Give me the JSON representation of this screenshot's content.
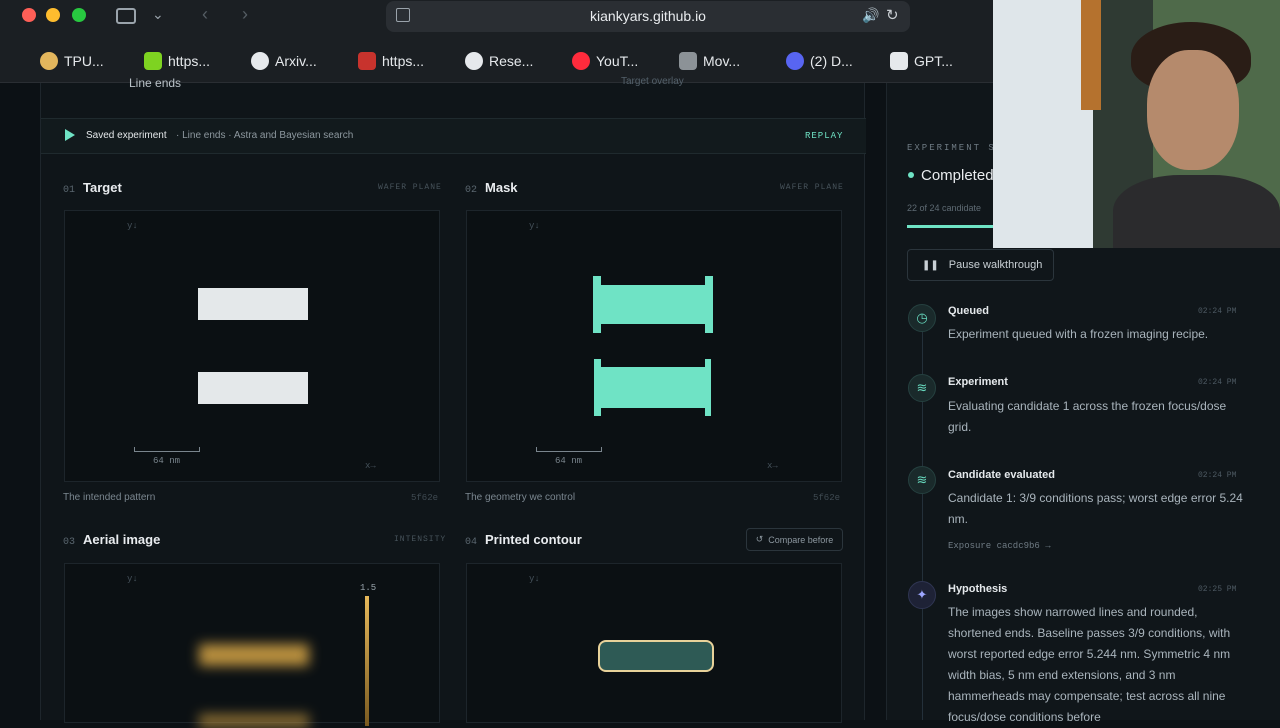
{
  "browser": {
    "url": "kiankyars.github.io",
    "bookmarks": [
      "TPU...",
      "https...",
      "Arxiv...",
      "https...",
      "Rese...",
      "YouT...",
      "Mov...",
      "(2) D...",
      "GPT..."
    ]
  },
  "main": {
    "header_partial": "Line ends",
    "header_right_partial": "Target overlay",
    "banner": {
      "saved_label": "Saved experiment",
      "detail": "· Line ends · Astra and Bayesian search",
      "replay": "REPLAY"
    },
    "panels": [
      {
        "num": "01",
        "title": "Target",
        "tag": "WAFER PLANE",
        "caption": "The intended pattern",
        "hash": "5f62e",
        "scale": "64 nm"
      },
      {
        "num": "02",
        "title": "Mask",
        "tag": "WAFER PLANE",
        "caption": "The geometry we control",
        "hash": "5f62e",
        "scale": "64 nm"
      },
      {
        "num": "03",
        "title": "Aerial image",
        "tag": "INTENSITY",
        "colorbar_max": "1.5"
      },
      {
        "num": "04",
        "title": "Printed contour",
        "compare_button": "Compare before"
      }
    ],
    "axis_y": "y↓",
    "axis_x": "x→"
  },
  "sidebar": {
    "section_label": "EXPERIMENT ST",
    "status": "Completed",
    "progress_text": "22 of 24 candidate",
    "progress_fraction": 0.917,
    "pause_button": "Pause walkthrough",
    "events": [
      {
        "title": "Queued",
        "time": "02:24 PM",
        "body": "Experiment queued with a frozen imaging recipe.",
        "icon": "clock-icon"
      },
      {
        "title": "Experiment",
        "time": "02:24 PM",
        "body": "Evaluating candidate 1 across the frozen focus/dose grid.",
        "icon": "waves-icon"
      },
      {
        "title": "Candidate evaluated",
        "time": "02:24 PM",
        "body": "Candidate 1: 3/9 conditions pass; worst edge error 5.24 nm.",
        "link": "Exposure cacdc9b6 →",
        "icon": "waves-icon"
      },
      {
        "title": "Hypothesis",
        "time": "02:25 PM",
        "body": "The images show narrowed lines and rounded, shortened ends. Baseline passes 3/9 conditions, with worst reported edge error 5.244 nm. Symmetric 4 nm width bias, 5 nm end extensions, and 3 nm hammerheads may compensate; test across all nine focus/dose conditions before",
        "icon": "sparkle-icon"
      }
    ]
  },
  "colors": {
    "accent": "#6fe3c5",
    "target_fill": "#e4e8ea",
    "aerial_glow": "#d6a546"
  }
}
